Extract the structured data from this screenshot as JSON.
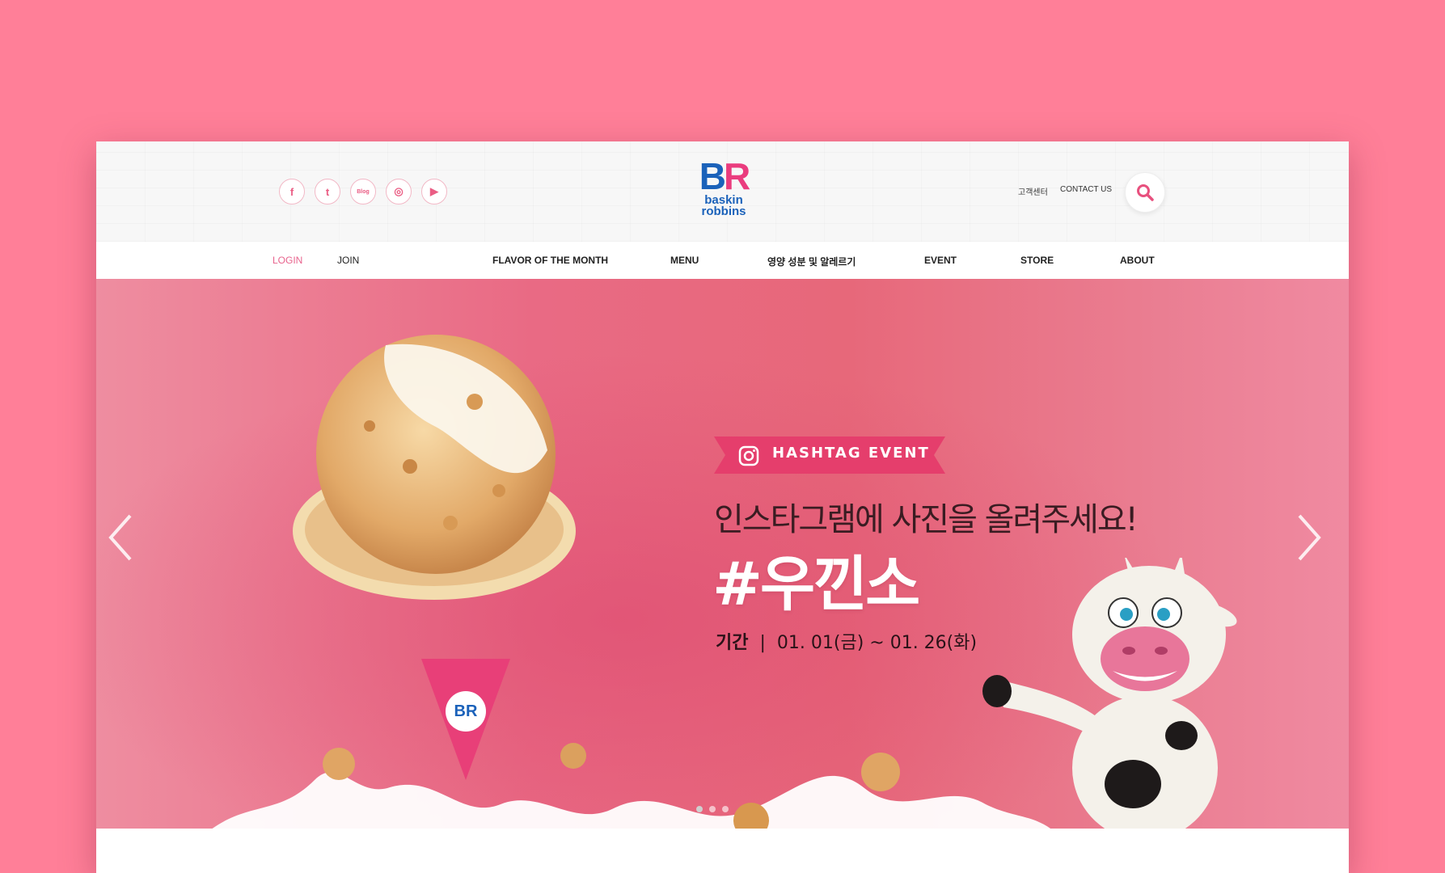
{
  "header": {
    "social": [
      {
        "name": "facebook-icon",
        "glyph": "f"
      },
      {
        "name": "twitter-icon",
        "glyph": "t"
      },
      {
        "name": "blog-icon",
        "glyph": "Blog"
      },
      {
        "name": "instagram-icon",
        "glyph": "◎"
      },
      {
        "name": "youtube-icon",
        "glyph": "▶"
      }
    ],
    "logo": {
      "mark_b": "B",
      "mark_r": "R",
      "line1": "baskin",
      "line2": "robbins"
    },
    "customer_center": "고객센터",
    "contact": "CONTACT US"
  },
  "nav": {
    "login": "LOGIN",
    "join": "JOIN",
    "items": [
      "FLAVOR OF THE MONTH",
      "MENU",
      "영양 성분 및 알레르기",
      "EVENT",
      "STORE",
      "ABOUT"
    ]
  },
  "hero": {
    "tag": "HASHTAG EVENT",
    "headline": "인스타그램에 사진을 올려주세요!",
    "hashtag": "#우낀소",
    "period_label": "기간",
    "period_sep": "|",
    "period_value": "01. 01(금) ~ 01. 26(화)",
    "cone_badge": "BR",
    "slides": 3,
    "active_slide": 0
  },
  "colors": {
    "brand_pink": "#ea3c7e",
    "brand_blue": "#1b62ba",
    "background": "#ff7f98"
  }
}
